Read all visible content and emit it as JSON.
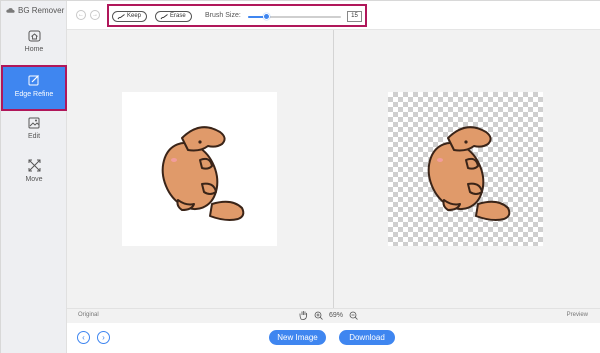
{
  "app": {
    "title": "BG Remover"
  },
  "sidebar": {
    "items": [
      {
        "label": "Home",
        "icon": "home-icon"
      },
      {
        "label": "Edge Refine",
        "icon": "edge-refine-icon",
        "active": true
      },
      {
        "label": "Edit",
        "icon": "edit-image-icon"
      },
      {
        "label": "Move",
        "icon": "move-arrows-icon"
      }
    ]
  },
  "toolbar": {
    "keep_label": "Keep",
    "erase_label": "Erase",
    "brush_label": "Brush Size:",
    "brush_value": "15",
    "brush_level_fraction": 0.2
  },
  "canvas": {
    "original_label": "Original",
    "preview_label": "Preview",
    "zoom": "69%"
  },
  "actions": {
    "new_image": "New Image",
    "download": "Download"
  },
  "colors": {
    "accent": "#3f86f0",
    "highlight_frame": "#b0175a",
    "platypus_body": "#e09a6a",
    "platypus_outline": "#3a2418"
  }
}
